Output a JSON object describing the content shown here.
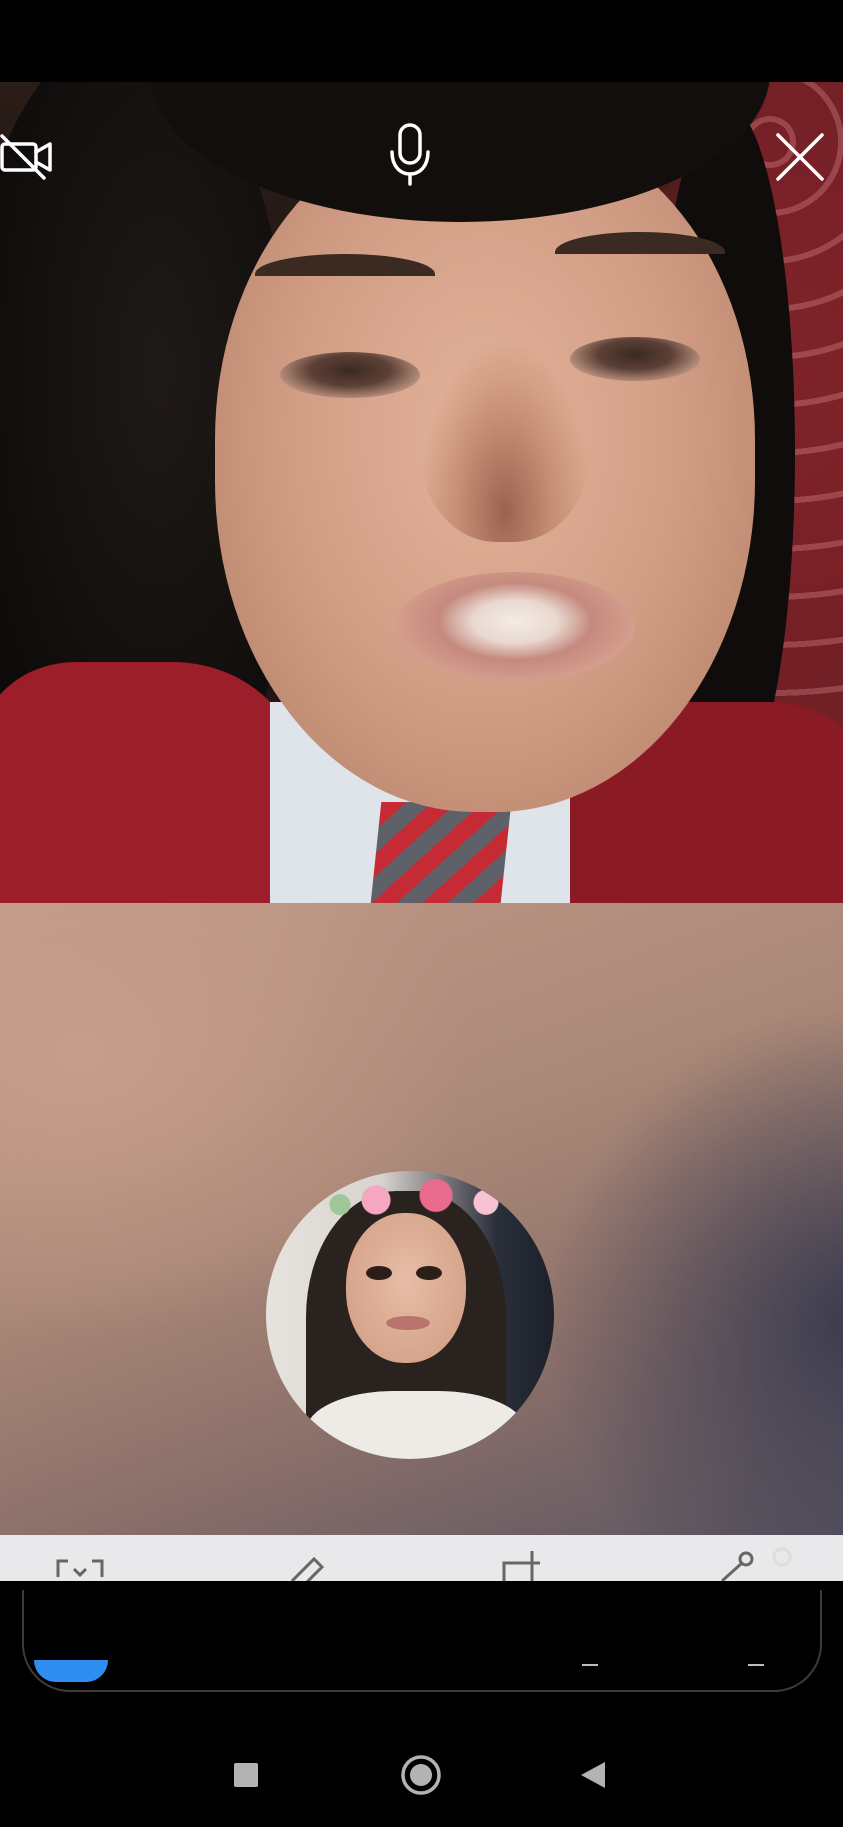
{
  "app": {
    "name": "video-call"
  },
  "call_controls": {
    "video_toggle_icon": "video-off-icon",
    "mic_icon": "microphone-icon",
    "close_icon": "close-icon"
  },
  "remote_video": {
    "label": ""
  },
  "local_preview": {
    "label": ""
  },
  "background_toolbar": {
    "icons": [
      "expand-icon",
      "edit-icon",
      "crop-icon",
      "share-icon"
    ]
  },
  "system_nav": {
    "recent_icon": "square-recent-icon",
    "home_icon": "circle-home-icon",
    "back_icon": "triangle-back-icon"
  },
  "colors": {
    "accent": "#2e8ff0",
    "status_bar": "#000000",
    "toolbar": "#e9e9ec"
  }
}
